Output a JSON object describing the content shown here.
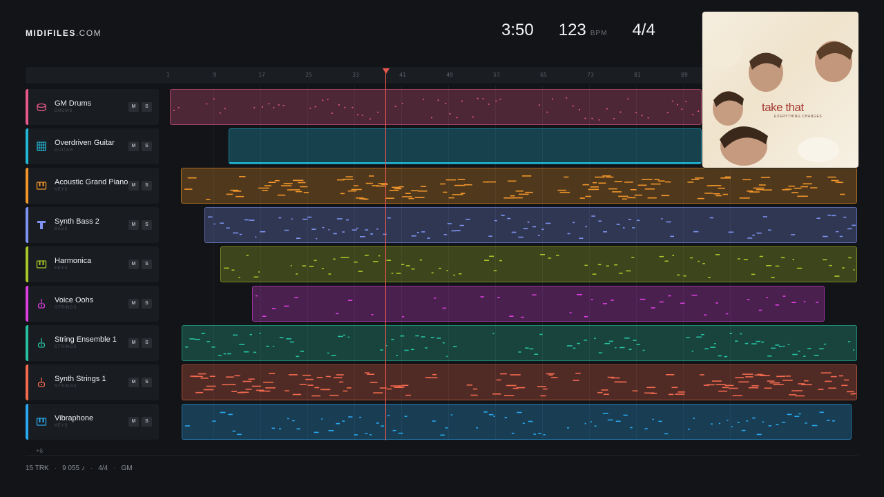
{
  "header": {
    "logo_bold": "MIDIFILES",
    "logo_light": ".COM",
    "duration": "3:50",
    "tempo": "123",
    "tempo_unit": "BPM",
    "time_signature": "4/4"
  },
  "ruler": {
    "ticks": [
      "1",
      "9",
      "17",
      "25",
      "33",
      "41",
      "49",
      "57",
      "65",
      "73",
      "81",
      "89"
    ]
  },
  "tracks": [
    {
      "name": "GM Drums",
      "category": "DRUMS",
      "color": "#e8598a",
      "icon": "drum-icon",
      "mute": "M",
      "solo": "S"
    },
    {
      "name": "Overdriven Guitar",
      "category": "GUITAR",
      "color": "#23b7d6",
      "icon": "guitar-icon",
      "mute": "M",
      "solo": "S"
    },
    {
      "name": "Acoustic Grand Piano",
      "category": "KEYS",
      "color": "#f0962b",
      "icon": "piano-keys-icon",
      "mute": "M",
      "solo": "S"
    },
    {
      "name": "Synth Bass 2",
      "category": "BASS",
      "color": "#7f93f2",
      "icon": "bass-icon",
      "mute": "M",
      "solo": "S"
    },
    {
      "name": "Harmonica",
      "category": "KEYS",
      "color": "#a9c72a",
      "icon": "piano-keys-icon",
      "mute": "M",
      "solo": "S"
    },
    {
      "name": "Voice Oohs",
      "category": "STRINGS",
      "color": "#dc3fe0",
      "icon": "violin-icon",
      "mute": "M",
      "solo": "S"
    },
    {
      "name": "String Ensemble 1",
      "category": "STRINGS",
      "color": "#27c1a2",
      "icon": "violin-icon",
      "mute": "M",
      "solo": "S"
    },
    {
      "name": "Synth Strings 1",
      "category": "STRINGS",
      "color": "#f2694e",
      "icon": "violin-icon",
      "mute": "M",
      "solo": "S"
    },
    {
      "name": "Vibraphone",
      "category": "KEYS",
      "color": "#2aa8ef",
      "icon": "piano-keys-icon",
      "mute": "M",
      "solo": "S"
    }
  ],
  "more_tracks": "+6",
  "footer": {
    "tracks": "15 TRK",
    "notes": "9 055 ♪",
    "signature": "4/4",
    "standard": "GM"
  },
  "album": {
    "band": "take that",
    "title": "EVERYTHING CHANGES"
  },
  "playhead_bar": 33
}
